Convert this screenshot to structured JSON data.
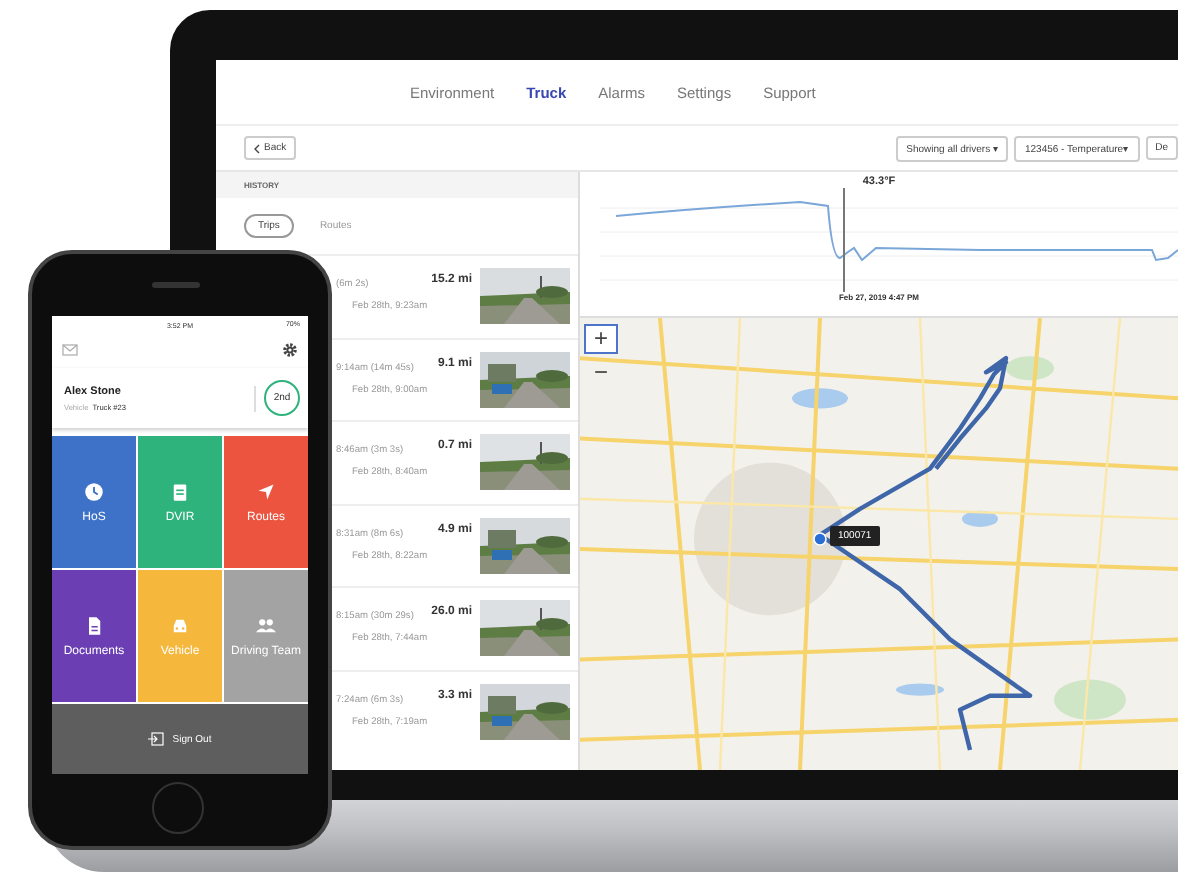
{
  "laptop": {
    "nav": [
      {
        "label": "Environment",
        "selected": false
      },
      {
        "label": "Truck",
        "selected": true
      },
      {
        "label": "Alarms",
        "selected": false
      },
      {
        "label": "Settings",
        "selected": false
      },
      {
        "label": "Support",
        "selected": false
      }
    ],
    "back_button": "Back",
    "filters": [
      "Showing all drivers ▾",
      "123456 - Temperature▾",
      "De"
    ],
    "history": {
      "header": "HISTORY",
      "tabs": [
        {
          "label": "Trips",
          "selected": true
        },
        {
          "label": "Routes",
          "selected": false
        }
      ],
      "trips": [
        {
          "title": "(6m 2s)",
          "date": "Feb 28th, 9:23am",
          "distance": "15.2 mi"
        },
        {
          "title": "9:14am (14m 45s)",
          "date": "Feb 28th, 9:00am",
          "distance": "9.1 mi"
        },
        {
          "title": "8:46am (3m 3s)",
          "date": "Feb 28th, 8:40am",
          "distance": "0.7 mi"
        },
        {
          "title": "8:31am (8m 6s)",
          "date": "Feb 28th, 8:22am",
          "distance": "4.9 mi"
        },
        {
          "title": "8:15am (30m 29s)",
          "date": "Feb 28th, 7:44am",
          "distance": "26.0 mi"
        },
        {
          "title": "7:24am (6m 3s)",
          "date": "Feb 28th, 7:19am",
          "distance": "3.3 mi"
        }
      ]
    },
    "chart": {
      "reading": "43.3°F",
      "marker_label": "Feb 27, 2019 4:47 PM"
    },
    "map": {
      "zoom_in": "+",
      "zoom_out": "−",
      "vehicle_label": "100071"
    }
  },
  "phone": {
    "status": {
      "time": "3:52 PM",
      "battery": "70%"
    },
    "driver": {
      "name": "Alex Stone",
      "vehicle_label": "Vehicle",
      "vehicle": "Truck #23",
      "badge": "2nd"
    },
    "tiles": [
      {
        "label": "HoS",
        "color": "#3d72c8"
      },
      {
        "label": "DVIR",
        "color": "#2eb37c"
      },
      {
        "label": "Routes",
        "color": "#ec5440"
      },
      {
        "label": "Documents",
        "color": "#6b3fb3"
      },
      {
        "label": "Vehicle",
        "color": "#f5b83d"
      },
      {
        "label": "Driving Team",
        "color": "#a3a3a3"
      }
    ],
    "sign_out": "Sign Out"
  }
}
